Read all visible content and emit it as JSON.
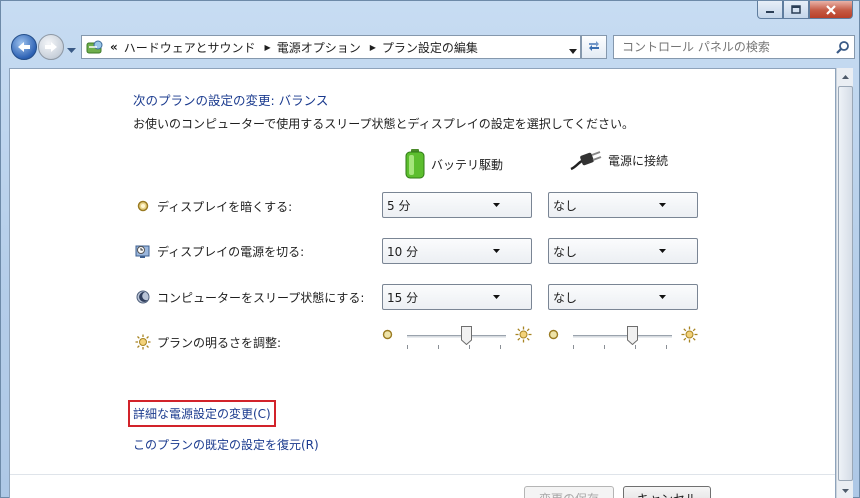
{
  "window": {
    "caption_buttons": [
      "minimize",
      "maximize",
      "close"
    ]
  },
  "navbar": {
    "breadcrumb": [
      "ハードウェアとサウンド",
      "電源オプション",
      "プラン設定の編集"
    ],
    "overflow_chevron": "«",
    "search": {
      "placeholder": "コントロール パネルの検索"
    }
  },
  "page": {
    "heading": "次のプランの設定の変更: バランス",
    "description": "お使いのコンピューターで使用するスリープ状態とディスプレイの設定を選択してください。",
    "columns": {
      "battery": "バッテリ駆動",
      "plugged_in": "電源に接続"
    },
    "rows": [
      {
        "icon": "dim-display-icon",
        "label": "ディスプレイを暗くする:",
        "battery": "5 分",
        "plugged": "なし"
      },
      {
        "icon": "display-off-icon",
        "label": "ディスプレイの電源を切る:",
        "battery": "10 分",
        "plugged": "なし"
      },
      {
        "icon": "sleep-icon",
        "label": "コンピューターをスリープ状態にする:",
        "battery": "15 分",
        "plugged": "なし"
      }
    ],
    "brightness": {
      "label": "プランの明るさを調整:",
      "battery_level": 0.6,
      "plugged_level": 0.6
    },
    "links": {
      "advanced": "詳細な電源設定の変更(C)",
      "restore": "このプランの既定の設定を復元(R)"
    }
  },
  "buttons": {
    "save": "変更の保存",
    "cancel": "キャンセル"
  },
  "colors": {
    "link": "#1a3a8e",
    "focus_outline": "#d2232a"
  }
}
